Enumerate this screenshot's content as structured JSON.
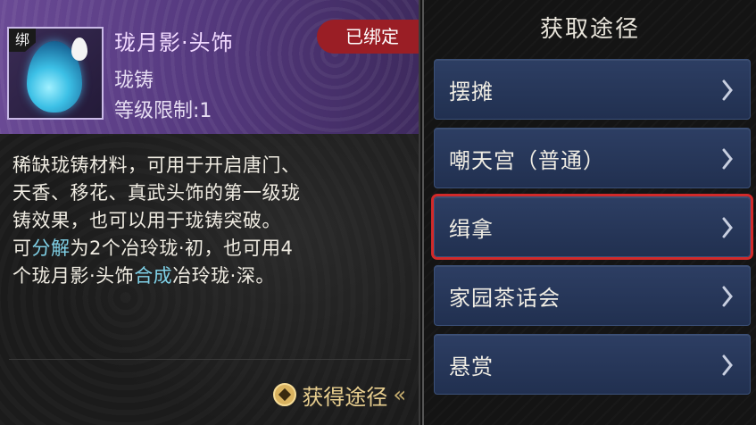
{
  "item": {
    "bind_tag": "绑",
    "name": "珑月影·头饰",
    "type": "珑铸",
    "level_label": "等级限制",
    "level_value": ":1",
    "bound_badge": "已绑定",
    "desc_lines": [
      "稀缺珑铸材料，可用于开启唐门、",
      "天香、移花、真武头饰的第一级珑",
      "铸效果，也可以用于珑铸突破。"
    ],
    "desc4_pre": "可",
    "desc4_hl": "分解",
    "desc4_post": "为2个冶玲珑·初，也可用4",
    "desc5_pre": "个珑月影·头饰",
    "desc5_hl": "合成",
    "desc5_post": "冶玲珑·深。",
    "obtain_label": "获得途径",
    "obtain_arrows": "«"
  },
  "panel": {
    "title": "获取途径",
    "sources": [
      {
        "label": "摆摊"
      },
      {
        "label": "嘲天宫（普通）"
      },
      {
        "label": "缉拿"
      },
      {
        "label": "家园茶话会"
      },
      {
        "label": "悬赏"
      }
    ],
    "selected_index": 2
  },
  "colors": {
    "header_purple": "#563a80",
    "badge_red": "#9a1e25",
    "highlight_cyan": "#7fd0e6",
    "button_blue": "#2d3e63",
    "selection_red": "#d22a2a",
    "gold": "#e9cf8f"
  },
  "icons": [
    "bind-tag-icon",
    "crystal-egg-icon",
    "droplet-icon",
    "gold-coin-icon",
    "chevron-right-icon"
  ]
}
